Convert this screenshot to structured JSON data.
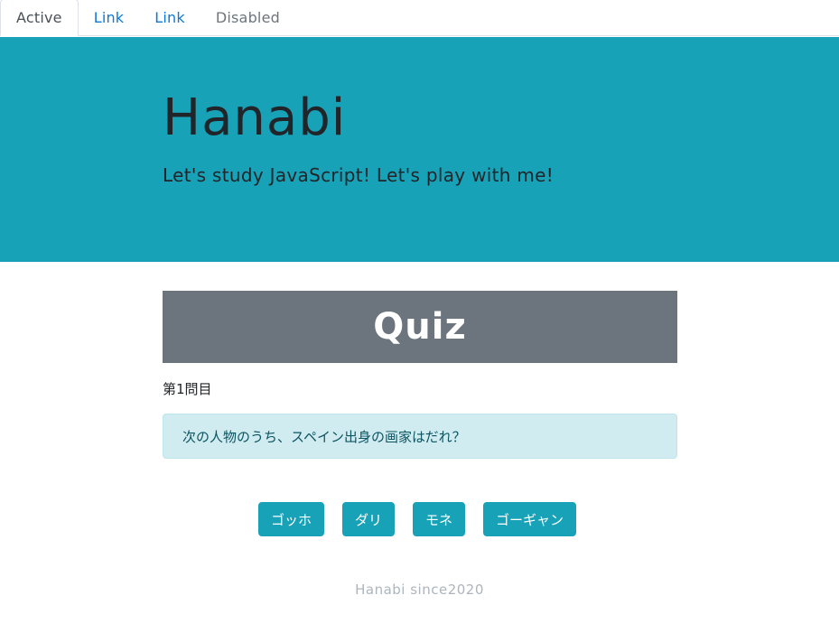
{
  "nav": {
    "tabs": [
      {
        "label": "Active",
        "state": "active"
      },
      {
        "label": "Link",
        "state": "link"
      },
      {
        "label": "Link",
        "state": "link"
      },
      {
        "label": "Disabled",
        "state": "disabled"
      }
    ]
  },
  "jumbotron": {
    "title": "Hanabi",
    "lead": "Let's study JavaScript! Let's play with me!",
    "background": "#17a2b8"
  },
  "quiz": {
    "heading": "Quiz",
    "question_number": "第1問目",
    "question": "次の人物のうち、スペイン出身の画家はだれ？",
    "answers": [
      "ゴッホ",
      "ダリ",
      "モネ",
      "ゴーギャン"
    ]
  },
  "footer": {
    "text": "Hanabi since2020"
  },
  "colors": {
    "accent": "#17a2b8",
    "header_gray": "#6c757d",
    "alert_bg": "#d1ecf1",
    "link": "#0d79d6"
  }
}
